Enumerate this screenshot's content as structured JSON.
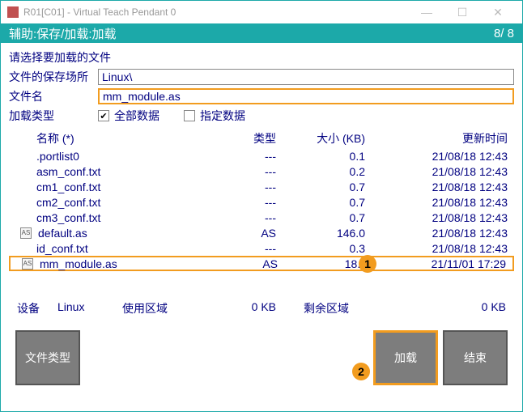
{
  "window": {
    "title": "R01[C01] - Virtual Teach Pendant 0"
  },
  "subheader": {
    "breadcrumb": "辅助:保存/加载:加载",
    "counter": "8/ 8"
  },
  "form": {
    "prompt": "请选择要加载的文件",
    "save_loc_label": "文件的保存场所",
    "save_loc_value": "Linux\\",
    "filename_label": "文件名",
    "filename_value": "mm_module.as",
    "load_type_label": "加载类型",
    "all_data_label": "全部数据",
    "specified_data_label": "指定数据",
    "name_col_sub": "名称  (*)"
  },
  "columns": {
    "type": "类型",
    "size": "大小 (KB)",
    "updated": "更新时间"
  },
  "files": [
    {
      "icon": "",
      "name": ".portlist0",
      "type": "---",
      "size": "0.1",
      "updated": "21/08/18 12:43"
    },
    {
      "icon": "",
      "name": "asm_conf.txt",
      "type": "---",
      "size": "0.2",
      "updated": "21/08/18 12:43"
    },
    {
      "icon": "",
      "name": "cm1_conf.txt",
      "type": "---",
      "size": "0.7",
      "updated": "21/08/18 12:43"
    },
    {
      "icon": "",
      "name": "cm2_conf.txt",
      "type": "---",
      "size": "0.7",
      "updated": "21/08/18 12:43"
    },
    {
      "icon": "",
      "name": "cm3_conf.txt",
      "type": "---",
      "size": "0.7",
      "updated": "21/08/18 12:43"
    },
    {
      "icon": "AS",
      "name": "default.as",
      "type": "AS",
      "size": "146.0",
      "updated": "21/08/18 12:43"
    },
    {
      "icon": "",
      "name": "id_conf.txt",
      "type": "---",
      "size": "0.3",
      "updated": "21/08/18 12:43"
    },
    {
      "icon": "AS",
      "name": "mm_module.as",
      "type": "AS",
      "size": "18.5",
      "updated": "21/11/01 17:29"
    }
  ],
  "badges": {
    "one": "1",
    "two": "2"
  },
  "status": {
    "device_label": "设备",
    "device_value": "Linux",
    "use_label": "使用区域",
    "use_value": "0 KB",
    "free_label": "剩余区域",
    "free_value": "0 KB"
  },
  "buttons": {
    "filetype": "文件类型",
    "load": "加载",
    "end": "结束"
  }
}
